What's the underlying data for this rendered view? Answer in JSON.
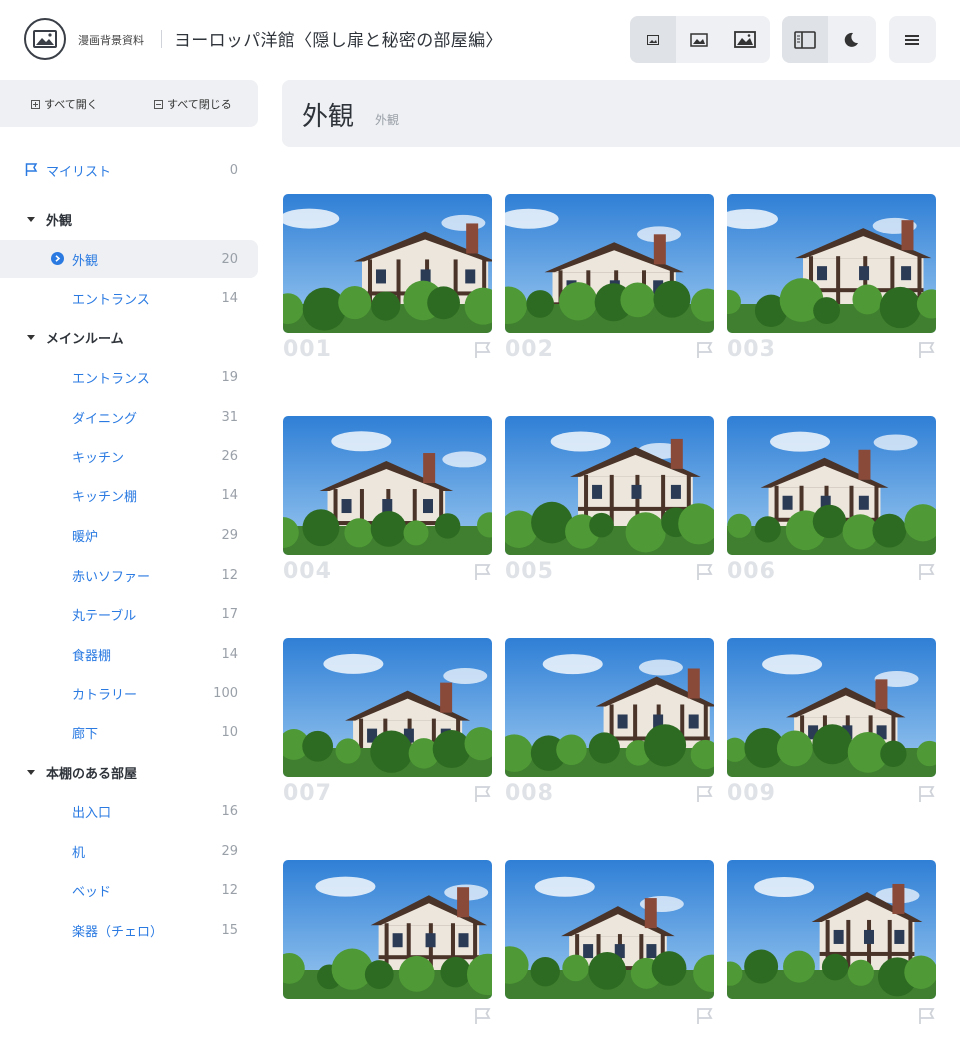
{
  "header": {
    "brand": "漫画背景資料",
    "title": "ヨーロッパ洋館〈隠し扉と秘密の部屋編〉",
    "icons": [
      "image-small-icon",
      "image-medium-icon",
      "image-large-icon",
      "sidebar-toggle-icon",
      "moon-icon",
      "menu-icon"
    ]
  },
  "sidebar": {
    "expand_all": "すべて開く",
    "collapse_all": "すべて閉じる",
    "mylist": {
      "label": "マイリスト",
      "count": "0"
    },
    "items": [
      {
        "type": "section",
        "label": "外観"
      },
      {
        "type": "item",
        "label": "外観",
        "count": "20",
        "active": true
      },
      {
        "type": "item",
        "label": "エントランス",
        "count": "14"
      },
      {
        "type": "section",
        "label": "メインルーム"
      },
      {
        "type": "item",
        "label": "エントランス",
        "count": "19"
      },
      {
        "type": "item",
        "label": "ダイニング",
        "count": "31"
      },
      {
        "type": "item",
        "label": "キッチン",
        "count": "26"
      },
      {
        "type": "item",
        "label": "キッチン棚",
        "count": "14"
      },
      {
        "type": "item",
        "label": "暖炉",
        "count": "29"
      },
      {
        "type": "item",
        "label": "赤いソファー",
        "count": "12"
      },
      {
        "type": "item",
        "label": "丸テーブル",
        "count": "17"
      },
      {
        "type": "item",
        "label": "食器棚",
        "count": "14"
      },
      {
        "type": "item",
        "label": "カトラリー",
        "count": "100"
      },
      {
        "type": "item",
        "label": "廊下",
        "count": "10"
      },
      {
        "type": "section",
        "label": "本棚のある部屋"
      },
      {
        "type": "item",
        "label": "出入口",
        "count": "16"
      },
      {
        "type": "item",
        "label": "机",
        "count": "29"
      },
      {
        "type": "item",
        "label": "ベッド",
        "count": "12"
      },
      {
        "type": "item",
        "label": "楽器（チェロ）",
        "count": "15"
      }
    ]
  },
  "main": {
    "section_title": "外観",
    "section_sub": "外観",
    "images": [
      {
        "num": "001"
      },
      {
        "num": "002"
      },
      {
        "num": "003"
      },
      {
        "num": "004"
      },
      {
        "num": "005"
      },
      {
        "num": "006"
      },
      {
        "num": "007"
      },
      {
        "num": "008"
      },
      {
        "num": "009"
      },
      {
        "num": ""
      },
      {
        "num": ""
      },
      {
        "num": ""
      }
    ]
  },
  "colors": {
    "accent": "#2a7ae2",
    "panel": "#eef0f3",
    "text": "#2f343b",
    "muted": "#9aa0a8"
  }
}
